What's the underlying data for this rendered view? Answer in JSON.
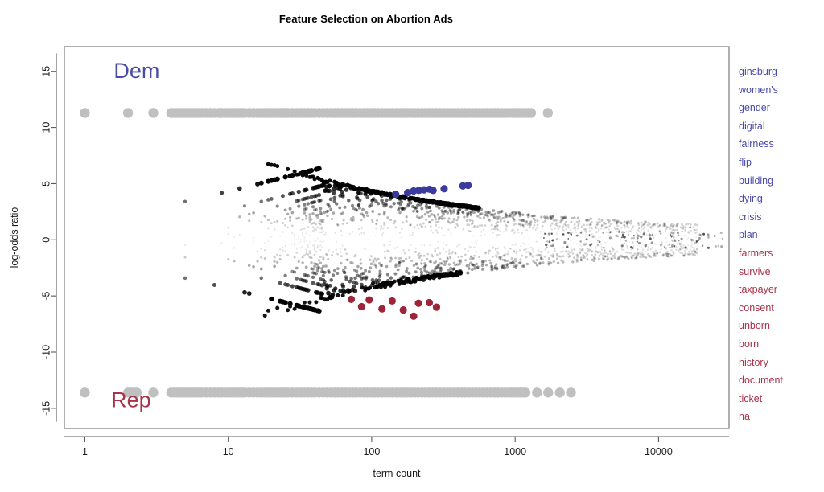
{
  "chart_data": {
    "type": "scatter",
    "title": "Feature Selection on Abortion Ads",
    "xlabel": "term count",
    "ylabel": "log-odds ratio",
    "xscale": "log",
    "xlim": [
      0.72,
      31000
    ],
    "ylim": [
      -16.8,
      17.2
    ],
    "xticks": [
      1,
      10,
      100,
      1000,
      10000
    ],
    "xtick_labels": [
      "1",
      "10",
      "100",
      "1000",
      "10000"
    ],
    "yticks": [
      -15,
      -10,
      -5,
      0,
      5,
      10,
      15
    ],
    "ytick_labels": [
      "-15",
      "-10",
      "-5",
      "0",
      "5",
      "10",
      "15"
    ],
    "grid": false,
    "legend_position": "right",
    "annotations": [
      {
        "text": "Dem",
        "x": 2.3,
        "y": 14.4,
        "color": "#4a4aa8"
      },
      {
        "text": "Rep",
        "x": 2.1,
        "y": -14.9,
        "color": "#a8324a"
      }
    ],
    "series": [
      {
        "name": "saturated-dem",
        "color": "#c0c0c0",
        "description": "terms appearing only in Democratic ads, capped log-odds ratio",
        "y_constant": 11.3,
        "x_values": [
          1,
          2,
          3,
          4,
          4.6,
          5,
          5.5,
          6,
          6.6,
          7,
          7.5,
          8,
          8.6,
          9,
          9.5,
          10,
          11,
          12,
          13,
          14,
          15,
          16,
          17,
          18,
          19,
          20,
          21,
          22,
          24,
          26,
          28,
          30,
          32,
          34,
          36,
          38,
          40,
          43,
          46,
          49,
          52,
          55,
          58,
          62,
          66,
          70,
          74,
          78,
          83,
          88,
          93,
          99,
          105,
          111,
          118,
          125,
          132,
          140,
          149,
          158,
          167,
          177,
          188,
          199,
          211,
          224,
          237,
          251,
          266,
          282,
          299,
          317,
          336,
          356,
          377,
          400,
          424,
          449,
          476,
          505,
          535,
          567,
          601,
          637,
          675,
          716,
          759,
          805,
          853,
          905,
          960,
          1110,
          1290,
          1690
        ]
      },
      {
        "name": "saturated-rep",
        "color": "#c0c0c0",
        "description": "terms appearing only in Republican ads, capped log-odds ratio",
        "y_constant": -13.6,
        "x_values": [
          1,
          2,
          2.3,
          3,
          4,
          4.6,
          5,
          5.5,
          6,
          6.5,
          7,
          7.5,
          8,
          8.5,
          9,
          9.5,
          10,
          11,
          12,
          13,
          14,
          15,
          16,
          17,
          18,
          19,
          20,
          21,
          22,
          24,
          26,
          28,
          30,
          32,
          34,
          36,
          38,
          40,
          43,
          46,
          49,
          52,
          55,
          58,
          62,
          66,
          70,
          74,
          78,
          83,
          88,
          93,
          99,
          105,
          111,
          118,
          125,
          132,
          140,
          149,
          158,
          167,
          177,
          188,
          199,
          211,
          224,
          237,
          251,
          266,
          282,
          299,
          317,
          336,
          356,
          377,
          400,
          424,
          449,
          476,
          505,
          535,
          567,
          601,
          637,
          675,
          716,
          759,
          805,
          900,
          1030,
          1180,
          1420,
          1700,
          2050,
          2450
        ]
      },
      {
        "name": "ordinary-terms",
        "color": "#000000",
        "description": "all remaining terms; point size and opacity scale with |log-odds ratio| significance"
      },
      {
        "name": "top-dem-terms",
        "color": "#3b3b9e",
        "description": "ten highest scoring Democratic terms, labelled at right",
        "points": [
          {
            "label": "ginsburg",
            "x": 196,
            "y": 4.35
          },
          {
            "label": "women's",
            "x": 213,
            "y": 4.4
          },
          {
            "label": "gender",
            "x": 232,
            "y": 4.45
          },
          {
            "label": "digital",
            "x": 253,
            "y": 4.5
          },
          {
            "label": "fairness",
            "x": 268,
            "y": 4.4
          },
          {
            "label": "flip",
            "x": 178,
            "y": 4.2
          },
          {
            "label": "building",
            "x": 147,
            "y": 4.05
          },
          {
            "label": "dying",
            "x": 320,
            "y": 4.55
          },
          {
            "label": "crisis",
            "x": 432,
            "y": 4.8
          },
          {
            "label": "plan",
            "x": 470,
            "y": 4.85
          }
        ]
      },
      {
        "name": "top-rep-terms",
        "color": "#9e2438",
        "description": "ten highest scoring Republican terms, labelled at right",
        "points": [
          {
            "label": "farmers",
            "x": 72,
            "y": -5.3
          },
          {
            "label": "survive",
            "x": 85,
            "y": -5.95
          },
          {
            "label": "taxpayer",
            "x": 96,
            "y": -5.35
          },
          {
            "label": "consent",
            "x": 118,
            "y": -6.15
          },
          {
            "label": "unborn",
            "x": 139,
            "y": -5.45
          },
          {
            "label": "born",
            "x": 166,
            "y": -6.25
          },
          {
            "label": "history",
            "x": 196,
            "y": -6.8
          },
          {
            "label": "document",
            "x": 212,
            "y": -5.65
          },
          {
            "label": "ticket",
            "x": 252,
            "y": -5.6
          },
          {
            "label": "na",
            "x": 283,
            "y": -6.0
          }
        ]
      }
    ],
    "legend_dem_words": [
      "ginsburg",
      "women's",
      "gender",
      "digital",
      "fairness",
      "flip",
      "building",
      "dying",
      "crisis",
      "plan"
    ],
    "legend_rep_words": [
      "farmers",
      "survive",
      "taxpayer",
      "consent",
      "unborn",
      "born",
      "history",
      "document",
      "ticket",
      "na"
    ]
  },
  "colors": {
    "dem": "#4a4aa8",
    "dem_point": "#3b3b9e",
    "rep": "#a8324a",
    "rep_point": "#9e2438",
    "saturated": "#c0c0c0",
    "ordinary": "#000000",
    "axis": "#585858",
    "frame": "#7a7a7a"
  }
}
